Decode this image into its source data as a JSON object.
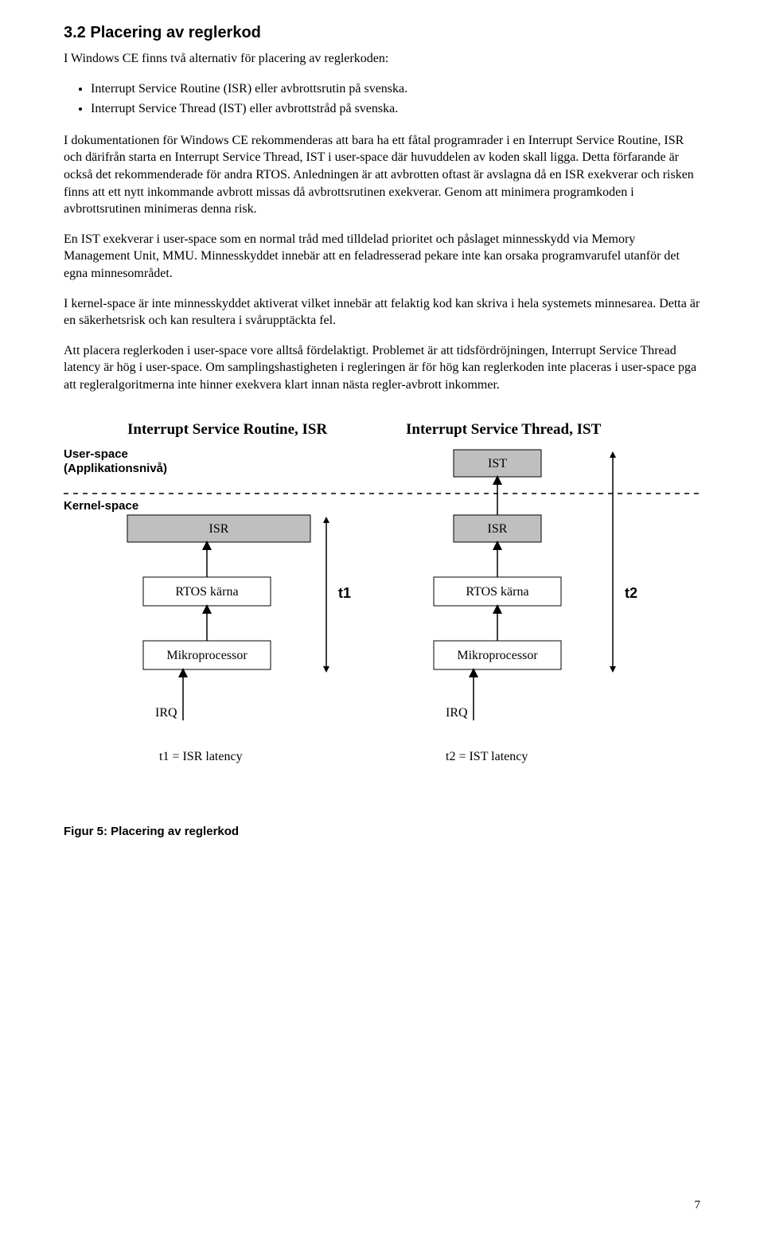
{
  "heading": "3.2 Placering av reglerkod",
  "intro": "I Windows CE finns två alternativ för placering av reglerkoden:",
  "bullets": [
    "Interrupt Service Routine (ISR) eller avbrottsrutin på svenska.",
    "Interrupt Service Thread (IST) eller avbrottstråd på svenska."
  ],
  "p1": "I dokumentationen för Windows CE rekommenderas att bara ha ett fåtal programrader i en Interrupt Service Routine, ISR och därifrån starta en Interrupt Service Thread, IST i user-space där huvuddelen av koden skall ligga. Detta förfarande är också det rekommenderade för andra RTOS. Anledningen är att avbrotten oftast är avslagna då en ISR exekverar och risken finns att ett nytt inkommande avbrott missas då avbrottsrutinen exekverar. Genom att minimera programkoden i avbrottsrutinen minimeras denna risk.",
  "p2": "En IST exekverar i user-space som en normal tråd med tilldelad prioritet och påslaget minnesskydd via Memory Management Unit, MMU. Minnesskyddet innebär att en feladresserad pekare inte kan orsaka programvarufel utanför det egna minnesområdet.",
  "p3": "I kernel-space är inte minnesskyddet aktiverat vilket innebär att felaktig kod kan skriva i hela systemets minnesarea. Detta är en säkerhetsrisk och kan resultera i svårupptäckta fel.",
  "p4": "Att placera reglerkoden i user-space vore alltså fördelaktigt. Problemet är att tidsfördröjningen, Interrupt Service Thread latency är hög i user-space. Om samplingshastigheten i regleringen är för hög kan reglerkoden inte placeras i user-space pga att regleralgoritmerna inte hinner exekvera klart innan nästa regler-avbrott inkommer.",
  "figure": {
    "left_title": "Interrupt Service Routine, ISR",
    "right_title": "Interrupt Service Thread, IST",
    "user_space": "User-space",
    "user_space_sub": "(Applikationsnivå)",
    "kernel_space": "Kernel-space",
    "isr": "ISR",
    "ist": "IST",
    "rtos": "RTOS kärna",
    "micro": "Mikroprocessor",
    "irq": "IRQ",
    "t1": "t1",
    "t2": "t2",
    "t1_legend": "t1 = ISR latency",
    "t2_legend": "t2 = IST latency",
    "caption": "Figur 5: Placering av reglerkod"
  },
  "page_number": "7"
}
